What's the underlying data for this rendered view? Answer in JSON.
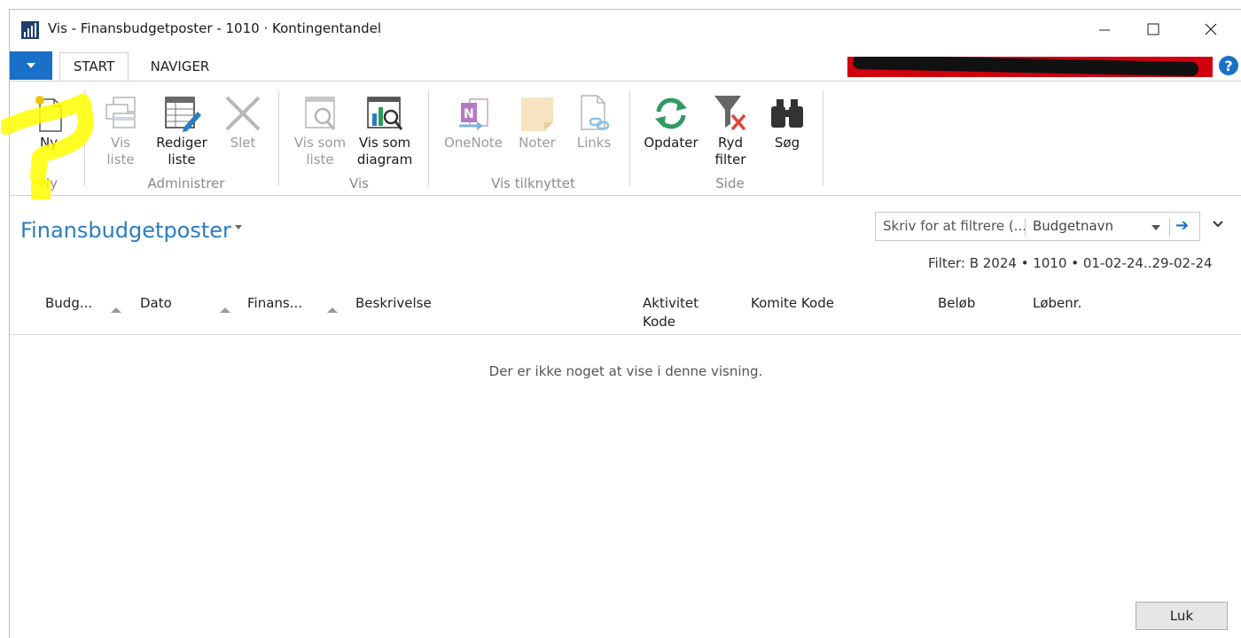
{
  "window": {
    "title": "Vis - Finansbudgetposter - 1010 · Kontingentandel"
  },
  "tabs": {
    "start": "START",
    "naviger": "NAVIGER"
  },
  "ribbon": {
    "ny": "Ny",
    "vis_liste": "Vis liste",
    "rediger_liste": "Rediger liste",
    "slet": "Slet",
    "vis_som_liste": "Vis som liste",
    "vis_som_diagram": "Vis som diagram",
    "onenote": "OneNote",
    "noter": "Noter",
    "links": "Links",
    "opdater": "Opdater",
    "ryd_filter": "Ryd filter",
    "soeg": "Søg",
    "groups": {
      "ny": "Ny",
      "administrer": "Administrer",
      "vis": "Vis",
      "vis_tilknyttet": "Vis tilknyttet",
      "side": "Side"
    }
  },
  "page": {
    "title": "Finansbudgetposter",
    "filter_placeholder": "Skriv for at filtrere (...",
    "filter_field": "Budgetnavn",
    "filter_text": "Filter: B 2024 • 1010 • 01-02-24..29-02-24",
    "empty_message": "Der er ikke noget at vise i denne visning."
  },
  "columns": {
    "budget": "Budg...",
    "dato": "Dato",
    "finans": "Finans...",
    "beskrivelse": "Beskrivelse",
    "aktivitet": "Aktivitet Kode",
    "komite": "Komite Kode",
    "beloeb": "Beløb",
    "loebenr": "Løbenr."
  },
  "footer": {
    "close": "Luk"
  },
  "colors": {
    "accent": "#1a6fc7",
    "title_blue": "#2b7cc3",
    "highlight": "#ffff00",
    "redaction": "#d1000e"
  },
  "icons": [
    "app-icon",
    "new-icon",
    "view-list-icon",
    "edit-list-icon",
    "delete-icon",
    "show-as-list-icon",
    "show-as-chart-icon",
    "onenote-icon",
    "notes-icon",
    "links-icon",
    "refresh-icon",
    "clear-filter-icon",
    "binoculars-icon",
    "help-icon",
    "chevron-down-icon",
    "arrow-right-icon"
  ]
}
